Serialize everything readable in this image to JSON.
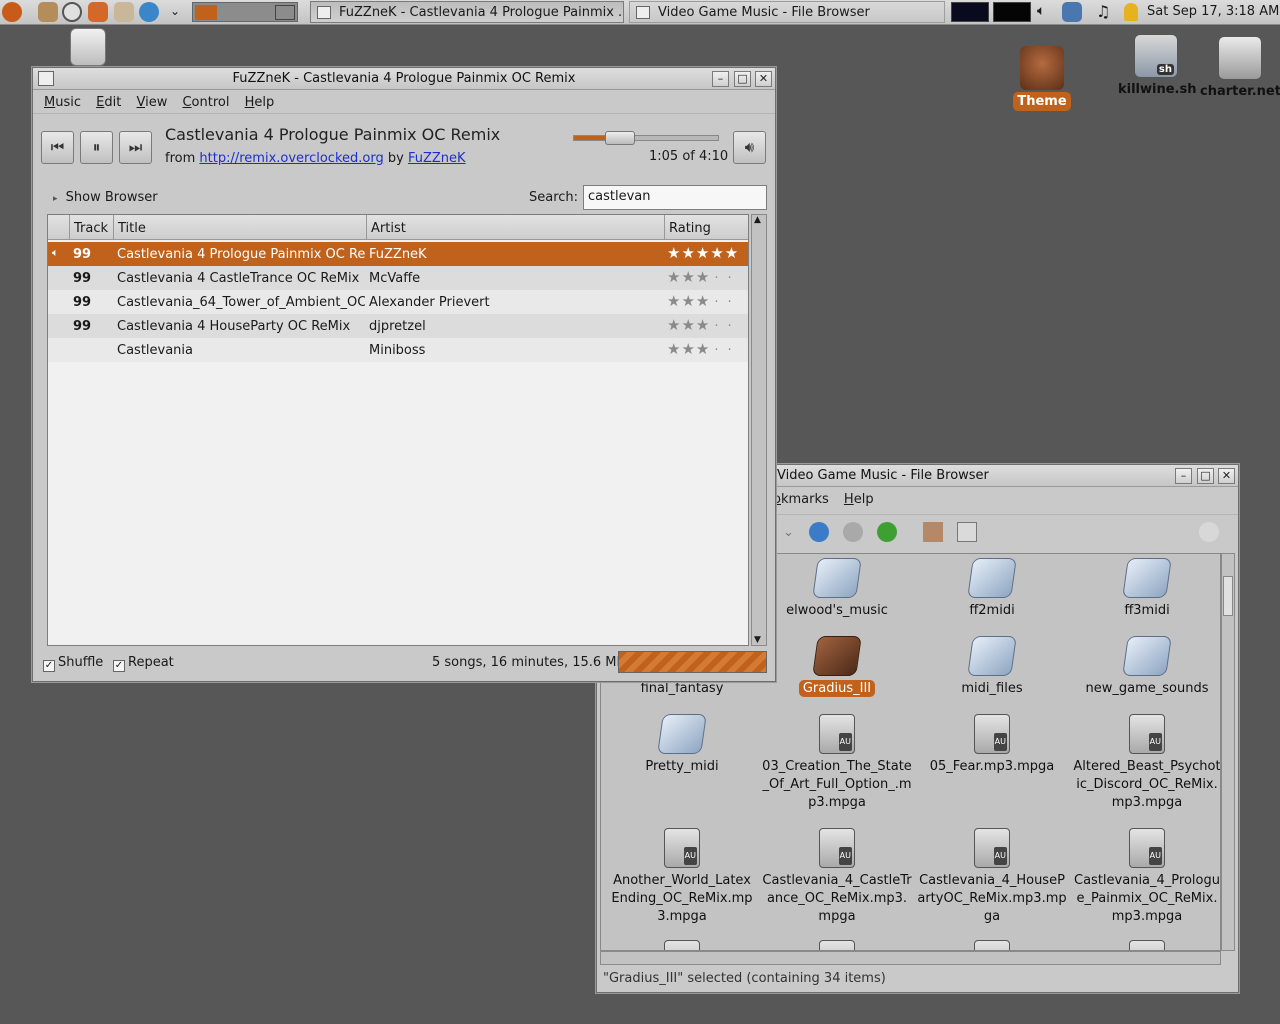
{
  "taskbar": {
    "tasks": [
      {
        "label": "FuZZneK - Castlevania 4 Prologue Painmix ..."
      },
      {
        "label": "Video Game Music - File Browser"
      }
    ],
    "clock": "Sat Sep 17,  3:18 AM"
  },
  "desktop": {
    "icons": [
      {
        "label": "Theme"
      },
      {
        "label": "killwine.sh",
        "badge": "sh"
      },
      {
        "label": "charter.net"
      }
    ]
  },
  "player": {
    "title": "FuZZneK - Castlevania 4 Prologue Painmix OC Remix",
    "menu": [
      "Music",
      "Edit",
      "View",
      "Control",
      "Help"
    ],
    "song_title": "Castlevania 4 Prologue Painmix OC Remix",
    "from_label": "from",
    "source_link": "http://remix.overclocked.org",
    "by_label": "by",
    "artist_link": "FuZZneK",
    "time": "1:05 of 4:10",
    "position_fraction": 0.26,
    "show_browser": "Show Browser",
    "search_label": "Search:",
    "search_value": "castlevan",
    "columns": [
      "Track",
      "Title",
      "Artist",
      "Rating"
    ],
    "rows": [
      {
        "track": "99",
        "title": "Castlevania 4 Prologue Painmix OC Remix",
        "artist": "FuZZneK",
        "rating": 5,
        "playing": true
      },
      {
        "track": "99",
        "title": "Castlevania 4 CastleTrance OC ReMix",
        "artist": "McVaffe",
        "rating": 3,
        "playing": false
      },
      {
        "track": "99",
        "title": "Castlevania_64_Tower_of_Ambient_OC",
        "artist": "Alexander Prievert",
        "rating": 3,
        "playing": false
      },
      {
        "track": "99",
        "title": "Castlevania 4 HouseParty OC ReMix",
        "artist": "djpretzel",
        "rating": 3,
        "playing": false
      },
      {
        "track": "",
        "title": "Castlevania",
        "artist": "Miniboss",
        "rating": 3,
        "playing": false
      }
    ],
    "shuffle_label": "Shuffle",
    "shuffle_checked": true,
    "repeat_label": "Repeat",
    "repeat_checked": true,
    "status": "5 songs, 16 minutes, 15.6 MB"
  },
  "browser": {
    "title": "Video Game Music - File Browser",
    "menu_partial": "okmarks",
    "menu_help": "Help",
    "items": [
      {
        "label": "elwood's_music",
        "kind": "folder"
      },
      {
        "label": "ff2midi",
        "kind": "folder"
      },
      {
        "label": "ff3midi",
        "kind": "folder"
      },
      {
        "label": "final_fantasy",
        "kind": "folder"
      },
      {
        "label": "Gradius_III",
        "kind": "folder-selected"
      },
      {
        "label": "midi_files",
        "kind": "folder"
      },
      {
        "label": "new_game_sounds",
        "kind": "folder"
      },
      {
        "label": "Pretty_midi",
        "kind": "folder"
      },
      {
        "label": "03_Creation_The_State_Of_Art_Full_Option_.mp3.mpga",
        "kind": "audio"
      },
      {
        "label": "05_Fear.mp3.mpga",
        "kind": "audio"
      },
      {
        "label": "Altered_Beast_Psychotic_Discord_OC_ReMix.mp3.mpga",
        "kind": "audio"
      },
      {
        "label": "Another_World_Latex Ending_OC_ReMix.mp3.mpga",
        "kind": "audio"
      },
      {
        "label": "Castlevania_4_CastleTrance_OC_ReMix.mp3.mpga",
        "kind": "audio"
      },
      {
        "label": "Castlevania_4_HousePartyOC_ReMix.mp3.mpga",
        "kind": "audio"
      },
      {
        "label": "Castlevania_4_Prologue_Painmix_OC_ReMix.mp3.mpga",
        "kind": "audio"
      }
    ],
    "status": "\"Gradius_III\" selected (containing 34 items)"
  }
}
